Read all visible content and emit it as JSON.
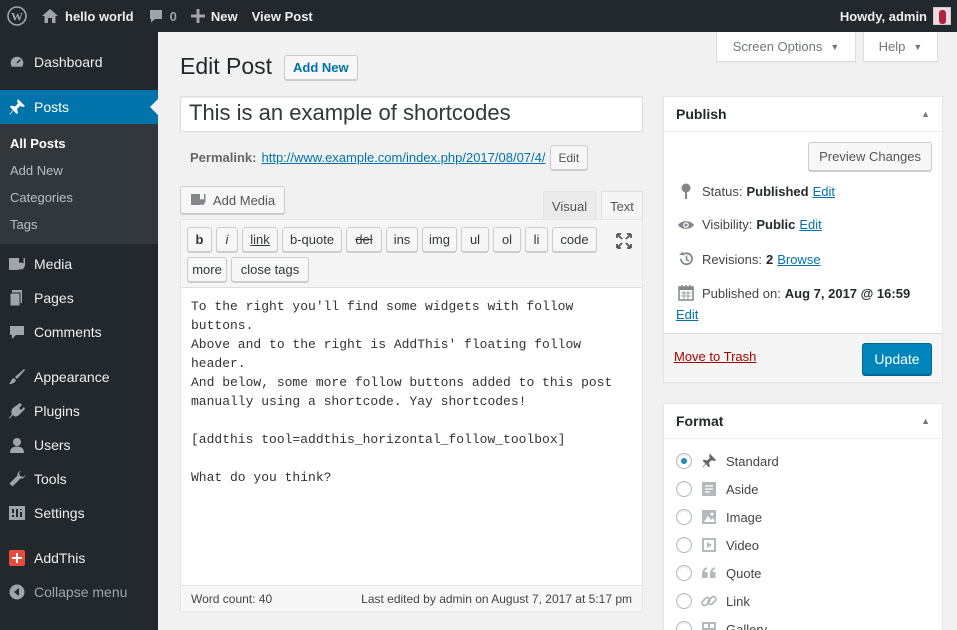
{
  "adminbar": {
    "wp_logo": "wordpress-logo-icon",
    "site_name": "hello world",
    "comments_count": "0",
    "new_label": "New",
    "view_post_label": "View Post",
    "greeting": "Howdy, admin"
  },
  "sidebar": {
    "items": [
      {
        "label": "Dashboard",
        "icon": "dashboard-icon"
      },
      {
        "label": "Posts",
        "icon": "pin-icon",
        "current": true
      },
      {
        "label": "Media",
        "icon": "media-icon"
      },
      {
        "label": "Pages",
        "icon": "pages-icon"
      },
      {
        "label": "Comments",
        "icon": "comments-icon"
      },
      {
        "label": "Appearance",
        "icon": "appearance-icon"
      },
      {
        "label": "Plugins",
        "icon": "plugins-icon"
      },
      {
        "label": "Users",
        "icon": "users-icon"
      },
      {
        "label": "Tools",
        "icon": "tools-icon"
      },
      {
        "label": "Settings",
        "icon": "settings-icon"
      },
      {
        "label": "AddThis",
        "icon": "addthis-icon"
      }
    ],
    "submenu": [
      "All Posts",
      "Add New",
      "Categories",
      "Tags"
    ],
    "collapse": "Collapse menu"
  },
  "screen_options": "Screen Options",
  "help": "Help",
  "page_title": "Edit Post",
  "add_new": "Add New",
  "post_title": "This is an example of shortcodes",
  "permalink": {
    "label": "Permalink:",
    "url": "http://www.example.com/index.php/2017/08/07/4/",
    "edit": "Edit"
  },
  "add_media": "Add Media",
  "editor_tabs": {
    "visual": "Visual",
    "text": "Text"
  },
  "quicktags": [
    "b",
    "i",
    "link",
    "b-quote",
    "del",
    "ins",
    "img",
    "ul",
    "ol",
    "li",
    "code",
    "more",
    "close tags"
  ],
  "content": "To the right you'll find some widgets with follow buttons.\nAbove and to the right is AddThis' floating follow header.\nAnd below, some more follow buttons added to this post\nmanually using a shortcode. Yay shortcodes!\n\n[addthis tool=addthis_horizontal_follow_toolbox]\n\nWhat do you think?",
  "status_bar": {
    "word_count": "Word count: 40",
    "last_edited": "Last edited by admin on August 7, 2017 at 5:17 pm"
  },
  "publish": {
    "title": "Publish",
    "preview": "Preview Changes",
    "status_label": "Status:",
    "status_value": "Published",
    "visibility_label": "Visibility:",
    "visibility_value": "Public",
    "revisions_label": "Revisions:",
    "revisions_value": "2",
    "browse": "Browse",
    "published_label": "Published on:",
    "published_value": "Aug 7, 2017 @ 16:59",
    "edit": "Edit",
    "trash": "Move to Trash",
    "update": "Update"
  },
  "format": {
    "title": "Format",
    "options": [
      {
        "label": "Standard",
        "icon": "pin-icon",
        "checked": true
      },
      {
        "label": "Aside",
        "icon": "aside-icon"
      },
      {
        "label": "Image",
        "icon": "image-icon"
      },
      {
        "label": "Video",
        "icon": "video-icon"
      },
      {
        "label": "Quote",
        "icon": "quote-icon"
      },
      {
        "label": "Link",
        "icon": "link-icon"
      },
      {
        "label": "Gallery",
        "icon": "gallery-icon"
      }
    ]
  },
  "colors": {
    "accent": "#0073aa",
    "sidebar_bg": "#23282d",
    "update_btn": "#0085ba",
    "trash": "#aa0000"
  }
}
